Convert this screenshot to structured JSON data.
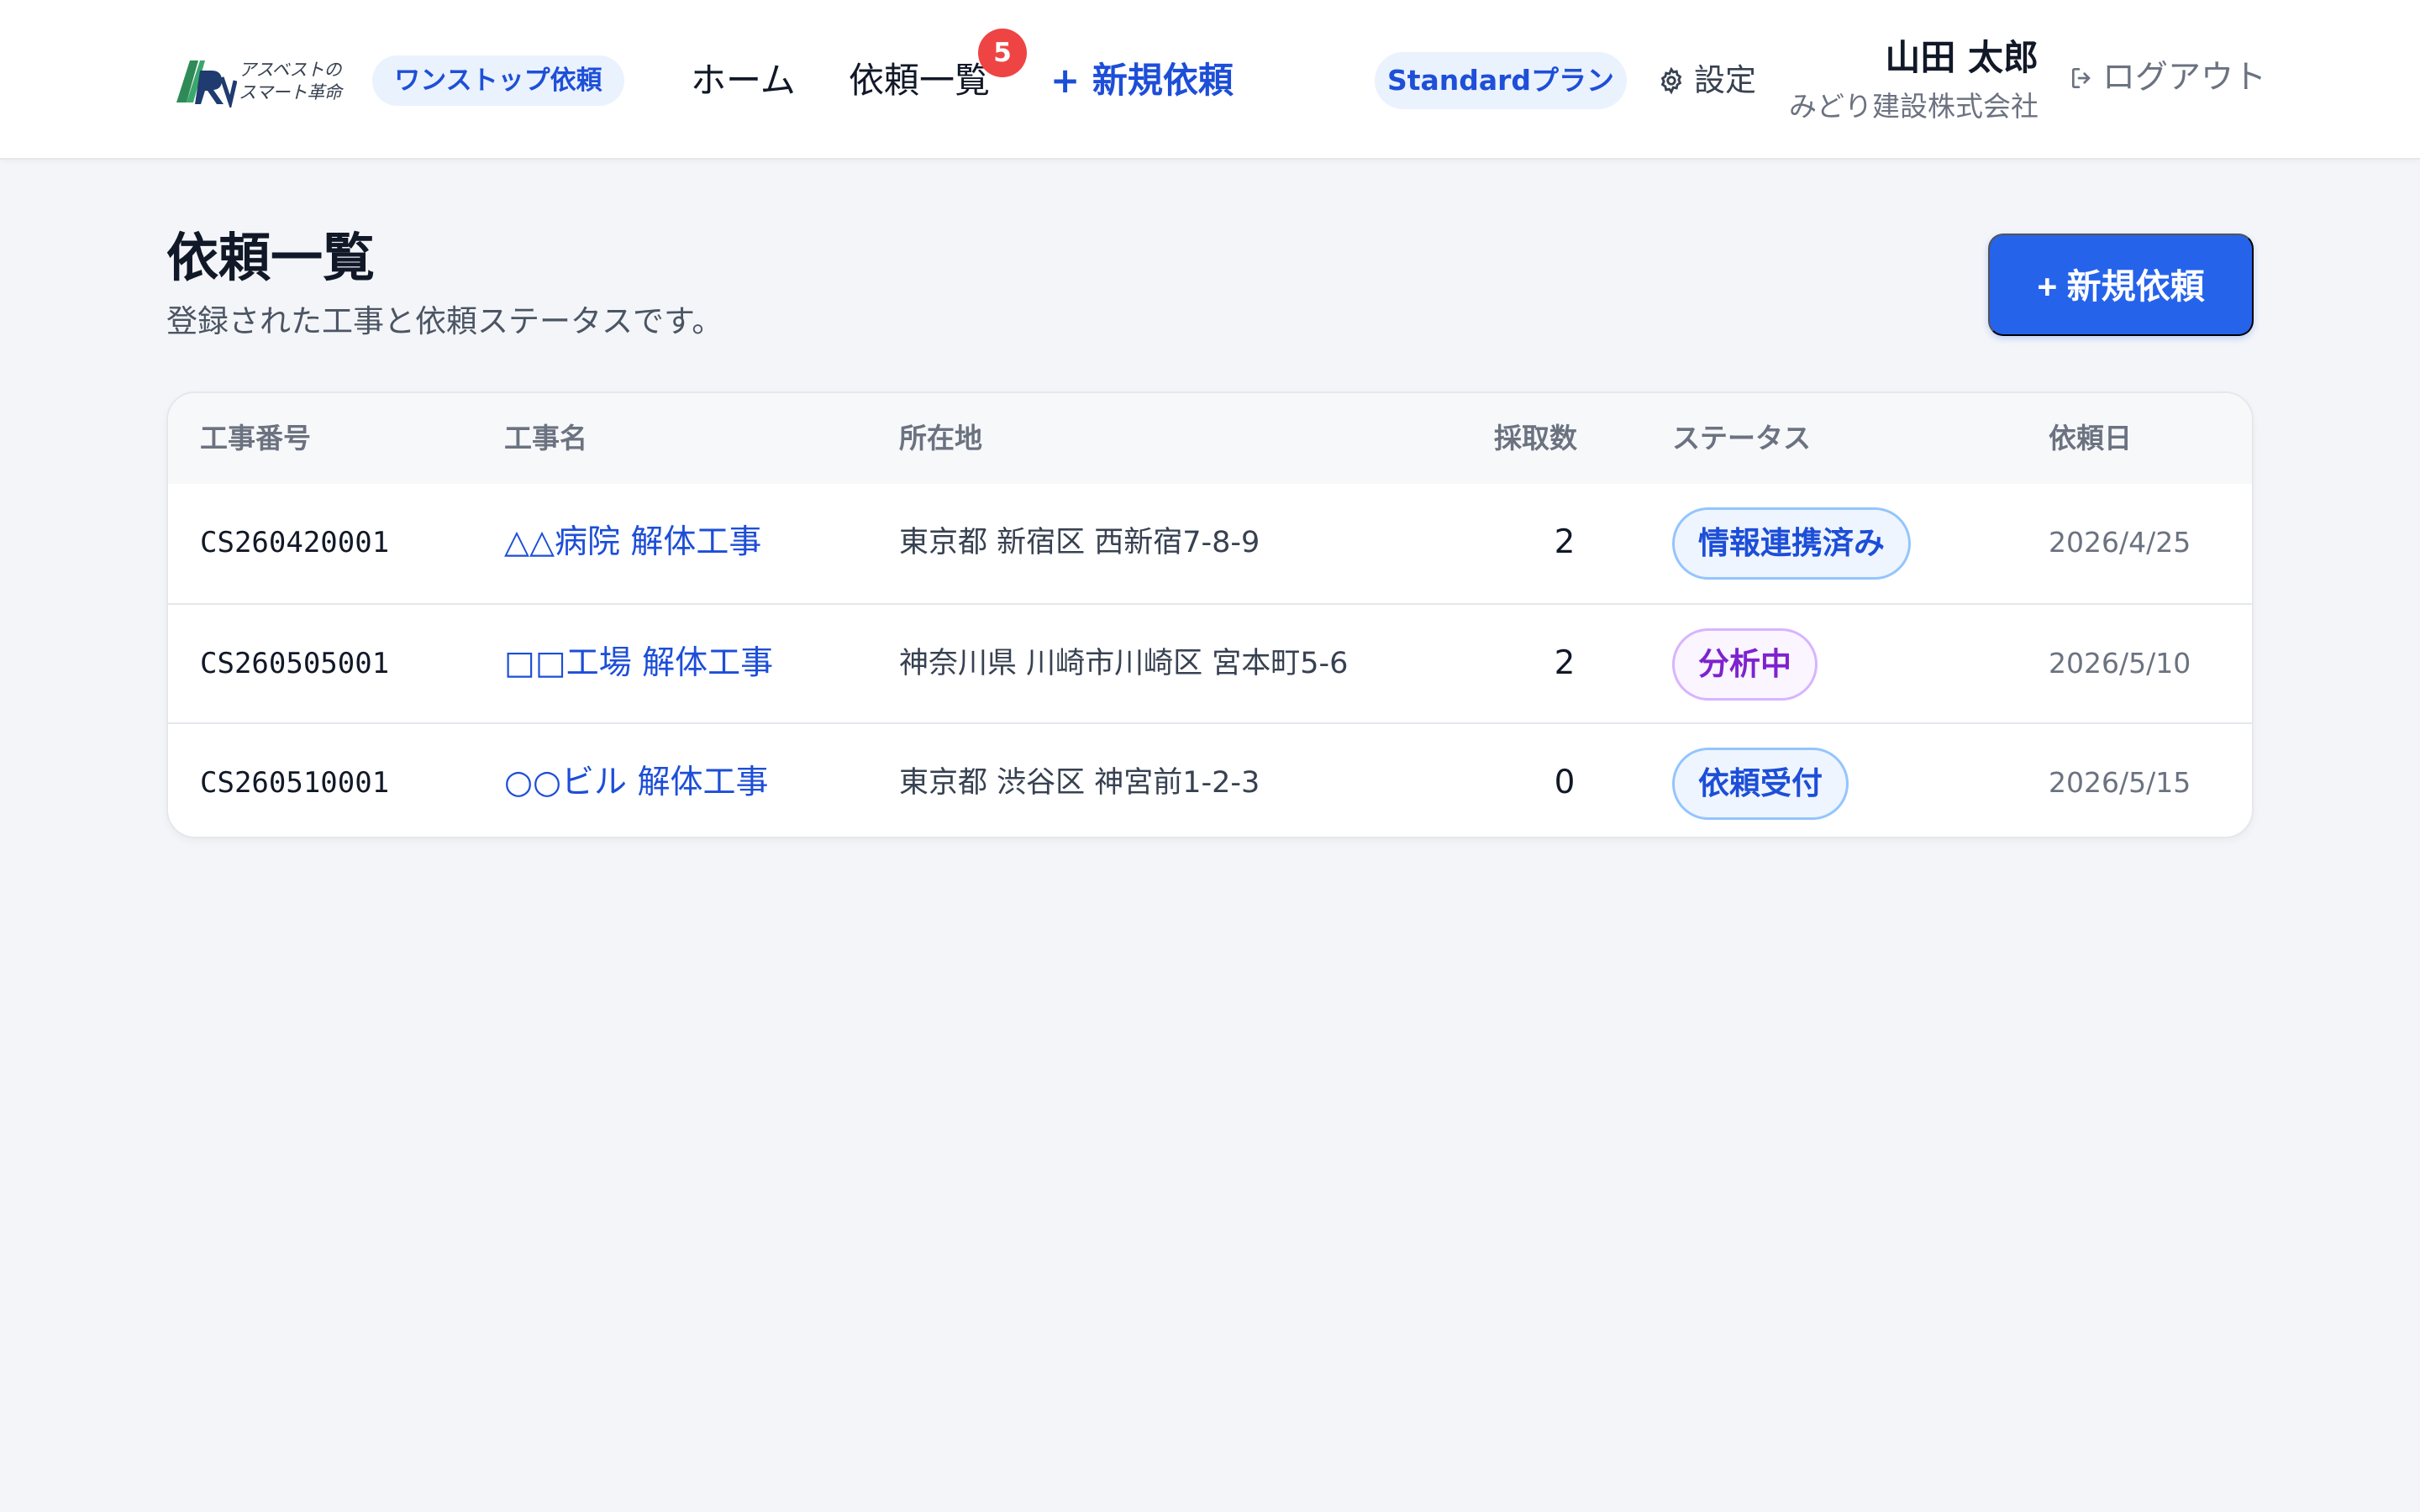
{
  "header": {
    "logo": {
      "line1": "アスベストの",
      "line2": "スマート革命"
    },
    "service_pill": "ワンストップ依頼",
    "nav": {
      "home": "ホーム",
      "list": "依頼一覧",
      "list_badge": "5",
      "new": "+ 新規依頼"
    },
    "plan_pill": "Standardプラン",
    "settings": "設定",
    "user": {
      "name": "山田 太郎",
      "company": "みどり建設株式会社"
    },
    "logout": "ログアウト"
  },
  "page": {
    "title": "依頼一覧",
    "subtitle": "登録された工事と依頼ステータスです。",
    "new_button": "+ 新規依頼"
  },
  "table": {
    "headers": {
      "number": "工事番号",
      "name": "工事名",
      "address": "所在地",
      "count": "採取数",
      "status": "ステータス",
      "date": "依頼日"
    },
    "rows": [
      {
        "number": "CS260420001",
        "name": "△△病院 解体工事",
        "address": "東京都 新宿区 西新宿7-8-9",
        "count": "2",
        "status": "情報連携済み",
        "date": "2026/4/25"
      },
      {
        "number": "CS260505001",
        "name": "□□工場 解体工事",
        "address": "神奈川県 川崎市川崎区 宮本町5-6",
        "count": "2",
        "status": "分析中",
        "date": "2026/5/10"
      },
      {
        "number": "CS260510001",
        "name": "○○ビル 解体工事",
        "address": "東京都 渋谷区 神宮前1-2-3",
        "count": "0",
        "status": "依頼受付",
        "date": "2026/5/15"
      }
    ]
  },
  "colors": {
    "primary": "#2563eb",
    "link": "#1d4ed8",
    "badge_alert": "#ef4444",
    "status_linked": "#1d4ed8",
    "status_analyzing": "#7e22ce",
    "status_received": "#1d4ed8"
  },
  "icons": {
    "settings": "gear-icon",
    "logout": "logout-icon"
  }
}
